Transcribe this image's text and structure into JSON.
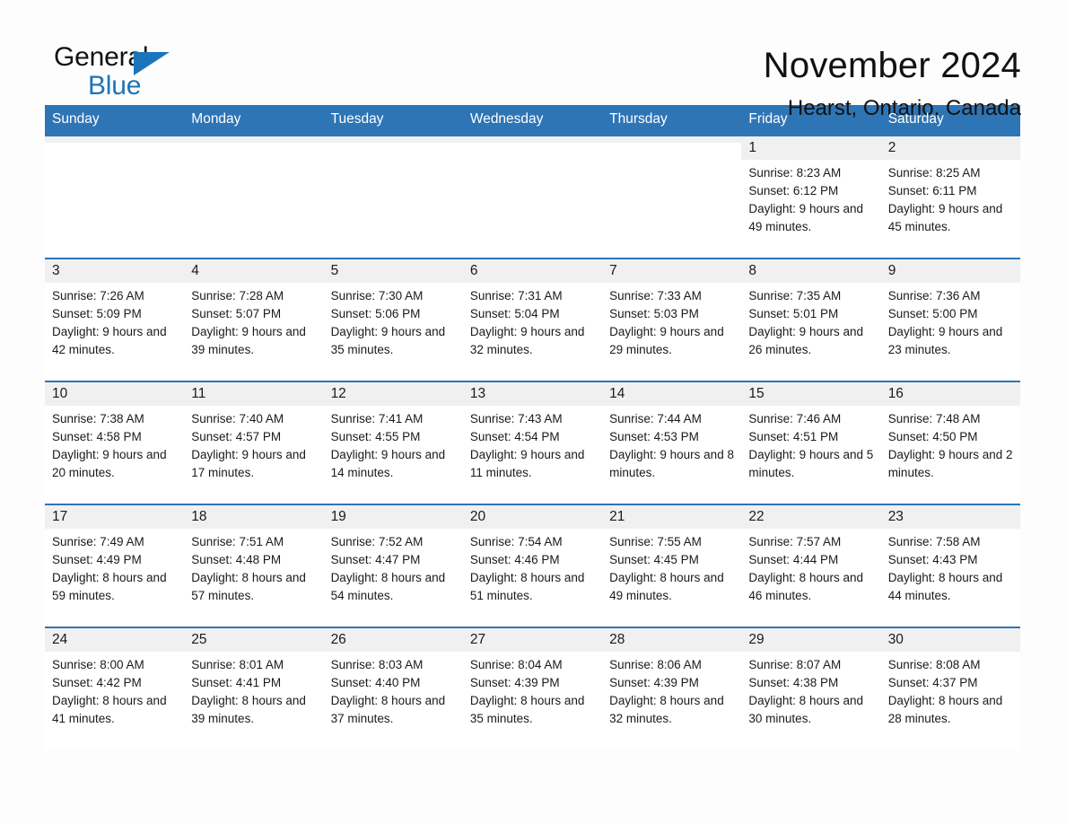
{
  "brand": {
    "name_part1": "General",
    "name_part2": "Blue",
    "accent_color": "#1b75bb"
  },
  "header": {
    "title": "November 2024",
    "subtitle": "Hearst, Ontario, Canada"
  },
  "theme": {
    "header_bg": "#2e75b6",
    "header_text": "#ffffff",
    "daynum_bg": "#f0f0f0",
    "cell_bg": "#ffffff",
    "page_bg": "#fdfdfd"
  },
  "weekdays": [
    "Sunday",
    "Monday",
    "Tuesday",
    "Wednesday",
    "Thursday",
    "Friday",
    "Saturday"
  ],
  "weeks": [
    [
      {
        "day": "",
        "sunrise": "",
        "sunset": "",
        "daylight": "",
        "blank": true
      },
      {
        "day": "",
        "sunrise": "",
        "sunset": "",
        "daylight": "",
        "blank": true
      },
      {
        "day": "",
        "sunrise": "",
        "sunset": "",
        "daylight": "",
        "blank": true
      },
      {
        "day": "",
        "sunrise": "",
        "sunset": "",
        "daylight": "",
        "blank": true
      },
      {
        "day": "",
        "sunrise": "",
        "sunset": "",
        "daylight": "",
        "blank": true
      },
      {
        "day": "1",
        "sunrise": "Sunrise: 8:23 AM",
        "sunset": "Sunset: 6:12 PM",
        "daylight": "Daylight: 9 hours and 49 minutes.",
        "blank": false
      },
      {
        "day": "2",
        "sunrise": "Sunrise: 8:25 AM",
        "sunset": "Sunset: 6:11 PM",
        "daylight": "Daylight: 9 hours and 45 minutes.",
        "blank": false
      }
    ],
    [
      {
        "day": "3",
        "sunrise": "Sunrise: 7:26 AM",
        "sunset": "Sunset: 5:09 PM",
        "daylight": "Daylight: 9 hours and 42 minutes.",
        "blank": false
      },
      {
        "day": "4",
        "sunrise": "Sunrise: 7:28 AM",
        "sunset": "Sunset: 5:07 PM",
        "daylight": "Daylight: 9 hours and 39 minutes.",
        "blank": false
      },
      {
        "day": "5",
        "sunrise": "Sunrise: 7:30 AM",
        "sunset": "Sunset: 5:06 PM",
        "daylight": "Daylight: 9 hours and 35 minutes.",
        "blank": false
      },
      {
        "day": "6",
        "sunrise": "Sunrise: 7:31 AM",
        "sunset": "Sunset: 5:04 PM",
        "daylight": "Daylight: 9 hours and 32 minutes.",
        "blank": false
      },
      {
        "day": "7",
        "sunrise": "Sunrise: 7:33 AM",
        "sunset": "Sunset: 5:03 PM",
        "daylight": "Daylight: 9 hours and 29 minutes.",
        "blank": false
      },
      {
        "day": "8",
        "sunrise": "Sunrise: 7:35 AM",
        "sunset": "Sunset: 5:01 PM",
        "daylight": "Daylight: 9 hours and 26 minutes.",
        "blank": false
      },
      {
        "day": "9",
        "sunrise": "Sunrise: 7:36 AM",
        "sunset": "Sunset: 5:00 PM",
        "daylight": "Daylight: 9 hours and 23 minutes.",
        "blank": false
      }
    ],
    [
      {
        "day": "10",
        "sunrise": "Sunrise: 7:38 AM",
        "sunset": "Sunset: 4:58 PM",
        "daylight": "Daylight: 9 hours and 20 minutes.",
        "blank": false
      },
      {
        "day": "11",
        "sunrise": "Sunrise: 7:40 AM",
        "sunset": "Sunset: 4:57 PM",
        "daylight": "Daylight: 9 hours and 17 minutes.",
        "blank": false
      },
      {
        "day": "12",
        "sunrise": "Sunrise: 7:41 AM",
        "sunset": "Sunset: 4:55 PM",
        "daylight": "Daylight: 9 hours and 14 minutes.",
        "blank": false
      },
      {
        "day": "13",
        "sunrise": "Sunrise: 7:43 AM",
        "sunset": "Sunset: 4:54 PM",
        "daylight": "Daylight: 9 hours and 11 minutes.",
        "blank": false
      },
      {
        "day": "14",
        "sunrise": "Sunrise: 7:44 AM",
        "sunset": "Sunset: 4:53 PM",
        "daylight": "Daylight: 9 hours and 8 minutes.",
        "blank": false
      },
      {
        "day": "15",
        "sunrise": "Sunrise: 7:46 AM",
        "sunset": "Sunset: 4:51 PM",
        "daylight": "Daylight: 9 hours and 5 minutes.",
        "blank": false
      },
      {
        "day": "16",
        "sunrise": "Sunrise: 7:48 AM",
        "sunset": "Sunset: 4:50 PM",
        "daylight": "Daylight: 9 hours and 2 minutes.",
        "blank": false
      }
    ],
    [
      {
        "day": "17",
        "sunrise": "Sunrise: 7:49 AM",
        "sunset": "Sunset: 4:49 PM",
        "daylight": "Daylight: 8 hours and 59 minutes.",
        "blank": false
      },
      {
        "day": "18",
        "sunrise": "Sunrise: 7:51 AM",
        "sunset": "Sunset: 4:48 PM",
        "daylight": "Daylight: 8 hours and 57 minutes.",
        "blank": false
      },
      {
        "day": "19",
        "sunrise": "Sunrise: 7:52 AM",
        "sunset": "Sunset: 4:47 PM",
        "daylight": "Daylight: 8 hours and 54 minutes.",
        "blank": false
      },
      {
        "day": "20",
        "sunrise": "Sunrise: 7:54 AM",
        "sunset": "Sunset: 4:46 PM",
        "daylight": "Daylight: 8 hours and 51 minutes.",
        "blank": false
      },
      {
        "day": "21",
        "sunrise": "Sunrise: 7:55 AM",
        "sunset": "Sunset: 4:45 PM",
        "daylight": "Daylight: 8 hours and 49 minutes.",
        "blank": false
      },
      {
        "day": "22",
        "sunrise": "Sunrise: 7:57 AM",
        "sunset": "Sunset: 4:44 PM",
        "daylight": "Daylight: 8 hours and 46 minutes.",
        "blank": false
      },
      {
        "day": "23",
        "sunrise": "Sunrise: 7:58 AM",
        "sunset": "Sunset: 4:43 PM",
        "daylight": "Daylight: 8 hours and 44 minutes.",
        "blank": false
      }
    ],
    [
      {
        "day": "24",
        "sunrise": "Sunrise: 8:00 AM",
        "sunset": "Sunset: 4:42 PM",
        "daylight": "Daylight: 8 hours and 41 minutes.",
        "blank": false
      },
      {
        "day": "25",
        "sunrise": "Sunrise: 8:01 AM",
        "sunset": "Sunset: 4:41 PM",
        "daylight": "Daylight: 8 hours and 39 minutes.",
        "blank": false
      },
      {
        "day": "26",
        "sunrise": "Sunrise: 8:03 AM",
        "sunset": "Sunset: 4:40 PM",
        "daylight": "Daylight: 8 hours and 37 minutes.",
        "blank": false
      },
      {
        "day": "27",
        "sunrise": "Sunrise: 8:04 AM",
        "sunset": "Sunset: 4:39 PM",
        "daylight": "Daylight: 8 hours and 35 minutes.",
        "blank": false
      },
      {
        "day": "28",
        "sunrise": "Sunrise: 8:06 AM",
        "sunset": "Sunset: 4:39 PM",
        "daylight": "Daylight: 8 hours and 32 minutes.",
        "blank": false
      },
      {
        "day": "29",
        "sunrise": "Sunrise: 8:07 AM",
        "sunset": "Sunset: 4:38 PM",
        "daylight": "Daylight: 8 hours and 30 minutes.",
        "blank": false
      },
      {
        "day": "30",
        "sunrise": "Sunrise: 8:08 AM",
        "sunset": "Sunset: 4:37 PM",
        "daylight": "Daylight: 8 hours and 28 minutes.",
        "blank": false
      }
    ]
  ]
}
